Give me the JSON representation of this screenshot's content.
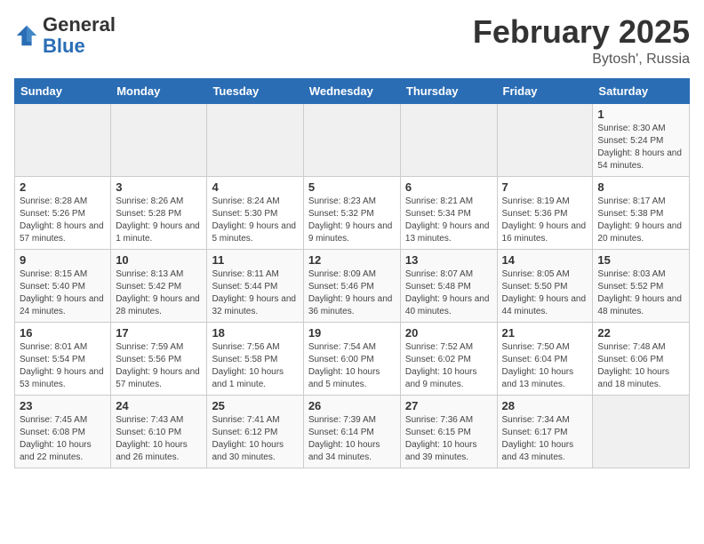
{
  "header": {
    "logo_general": "General",
    "logo_blue": "Blue",
    "title": "February 2025",
    "subtitle": "Bytosh', Russia"
  },
  "weekdays": [
    "Sunday",
    "Monday",
    "Tuesday",
    "Wednesday",
    "Thursday",
    "Friday",
    "Saturday"
  ],
  "weeks": [
    [
      {
        "day": "",
        "detail": ""
      },
      {
        "day": "",
        "detail": ""
      },
      {
        "day": "",
        "detail": ""
      },
      {
        "day": "",
        "detail": ""
      },
      {
        "day": "",
        "detail": ""
      },
      {
        "day": "",
        "detail": ""
      },
      {
        "day": "1",
        "detail": "Sunrise: 8:30 AM\nSunset: 5:24 PM\nDaylight: 8 hours and 54 minutes."
      }
    ],
    [
      {
        "day": "2",
        "detail": "Sunrise: 8:28 AM\nSunset: 5:26 PM\nDaylight: 8 hours and 57 minutes."
      },
      {
        "day": "3",
        "detail": "Sunrise: 8:26 AM\nSunset: 5:28 PM\nDaylight: 9 hours and 1 minute."
      },
      {
        "day": "4",
        "detail": "Sunrise: 8:24 AM\nSunset: 5:30 PM\nDaylight: 9 hours and 5 minutes."
      },
      {
        "day": "5",
        "detail": "Sunrise: 8:23 AM\nSunset: 5:32 PM\nDaylight: 9 hours and 9 minutes."
      },
      {
        "day": "6",
        "detail": "Sunrise: 8:21 AM\nSunset: 5:34 PM\nDaylight: 9 hours and 13 minutes."
      },
      {
        "day": "7",
        "detail": "Sunrise: 8:19 AM\nSunset: 5:36 PM\nDaylight: 9 hours and 16 minutes."
      },
      {
        "day": "8",
        "detail": "Sunrise: 8:17 AM\nSunset: 5:38 PM\nDaylight: 9 hours and 20 minutes."
      }
    ],
    [
      {
        "day": "9",
        "detail": "Sunrise: 8:15 AM\nSunset: 5:40 PM\nDaylight: 9 hours and 24 minutes."
      },
      {
        "day": "10",
        "detail": "Sunrise: 8:13 AM\nSunset: 5:42 PM\nDaylight: 9 hours and 28 minutes."
      },
      {
        "day": "11",
        "detail": "Sunrise: 8:11 AM\nSunset: 5:44 PM\nDaylight: 9 hours and 32 minutes."
      },
      {
        "day": "12",
        "detail": "Sunrise: 8:09 AM\nSunset: 5:46 PM\nDaylight: 9 hours and 36 minutes."
      },
      {
        "day": "13",
        "detail": "Sunrise: 8:07 AM\nSunset: 5:48 PM\nDaylight: 9 hours and 40 minutes."
      },
      {
        "day": "14",
        "detail": "Sunrise: 8:05 AM\nSunset: 5:50 PM\nDaylight: 9 hours and 44 minutes."
      },
      {
        "day": "15",
        "detail": "Sunrise: 8:03 AM\nSunset: 5:52 PM\nDaylight: 9 hours and 48 minutes."
      }
    ],
    [
      {
        "day": "16",
        "detail": "Sunrise: 8:01 AM\nSunset: 5:54 PM\nDaylight: 9 hours and 53 minutes."
      },
      {
        "day": "17",
        "detail": "Sunrise: 7:59 AM\nSunset: 5:56 PM\nDaylight: 9 hours and 57 minutes."
      },
      {
        "day": "18",
        "detail": "Sunrise: 7:56 AM\nSunset: 5:58 PM\nDaylight: 10 hours and 1 minute."
      },
      {
        "day": "19",
        "detail": "Sunrise: 7:54 AM\nSunset: 6:00 PM\nDaylight: 10 hours and 5 minutes."
      },
      {
        "day": "20",
        "detail": "Sunrise: 7:52 AM\nSunset: 6:02 PM\nDaylight: 10 hours and 9 minutes."
      },
      {
        "day": "21",
        "detail": "Sunrise: 7:50 AM\nSunset: 6:04 PM\nDaylight: 10 hours and 13 minutes."
      },
      {
        "day": "22",
        "detail": "Sunrise: 7:48 AM\nSunset: 6:06 PM\nDaylight: 10 hours and 18 minutes."
      }
    ],
    [
      {
        "day": "23",
        "detail": "Sunrise: 7:45 AM\nSunset: 6:08 PM\nDaylight: 10 hours and 22 minutes."
      },
      {
        "day": "24",
        "detail": "Sunrise: 7:43 AM\nSunset: 6:10 PM\nDaylight: 10 hours and 26 minutes."
      },
      {
        "day": "25",
        "detail": "Sunrise: 7:41 AM\nSunset: 6:12 PM\nDaylight: 10 hours and 30 minutes."
      },
      {
        "day": "26",
        "detail": "Sunrise: 7:39 AM\nSunset: 6:14 PM\nDaylight: 10 hours and 34 minutes."
      },
      {
        "day": "27",
        "detail": "Sunrise: 7:36 AM\nSunset: 6:15 PM\nDaylight: 10 hours and 39 minutes."
      },
      {
        "day": "28",
        "detail": "Sunrise: 7:34 AM\nSunset: 6:17 PM\nDaylight: 10 hours and 43 minutes."
      },
      {
        "day": "",
        "detail": ""
      }
    ]
  ]
}
